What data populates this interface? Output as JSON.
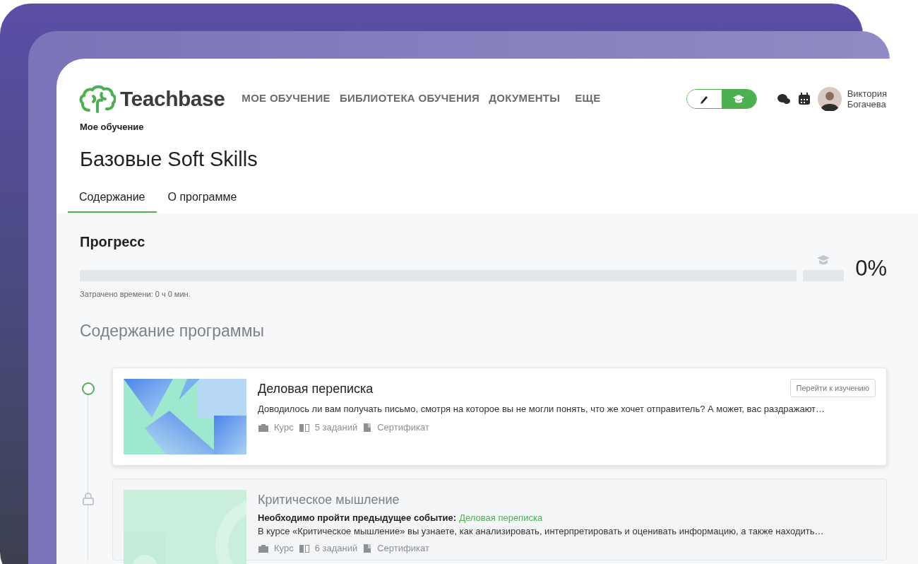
{
  "brand": {
    "name": "Teachbase"
  },
  "nav": [
    {
      "label": "МОЕ ОБУЧЕНИЕ"
    },
    {
      "label": "БИБЛИОТЕКА ОБУЧЕНИЯ"
    },
    {
      "label": "ДОКУМЕНТЫ"
    },
    {
      "label": "ЕЩЕ"
    }
  ],
  "mode_toggle": [
    {
      "kind": "edit",
      "selected": false
    },
    {
      "kind": "learn",
      "selected": true
    }
  ],
  "user": {
    "first_name": "Виктория",
    "last_name": "Богачева"
  },
  "breadcrumb": "Мое обучение",
  "title": "Базовые Soft Skills",
  "tabs": [
    {
      "label": "Содержание",
      "selected": true
    },
    {
      "label": "О программе",
      "selected": false
    }
  ],
  "progress": {
    "heading": "Прогресс",
    "level": 0,
    "percent": "0%",
    "certificate": {
      "level": 0
    },
    "time_spent": "Затрачено времени: 0 ч 0 мин."
  },
  "section_title": "Содержание программы",
  "courses": [
    {
      "title": "Деловая переписка",
      "locked": false,
      "button": "Перейти к изучению",
      "description": "Доводилось ли вам получать письмо, смотря на которое вы не могли понять, что же хочет отправитель? А может, вас раздражают…",
      "meta": [
        {
          "kind": "type",
          "label": "Курс"
        },
        {
          "kind": "tasks",
          "label": "5 заданий"
        },
        {
          "kind": "certificate",
          "label": "Сертификат"
        }
      ]
    },
    {
      "title": "Критическое мышление",
      "locked": true,
      "requirement_label": "Необходимо пройти предыдущее событие:",
      "requirement_link": "Деловая переписка",
      "description": "В курсе «Критическое мышление» вы узнаете, как анализировать, интерпретировать и оценивать информацию, а также находить…",
      "meta": [
        {
          "kind": "type",
          "label": "Курс"
        },
        {
          "kind": "tasks",
          "label": "6 заданий"
        },
        {
          "kind": "certificate",
          "label": "Сертификат"
        }
      ]
    }
  ]
}
